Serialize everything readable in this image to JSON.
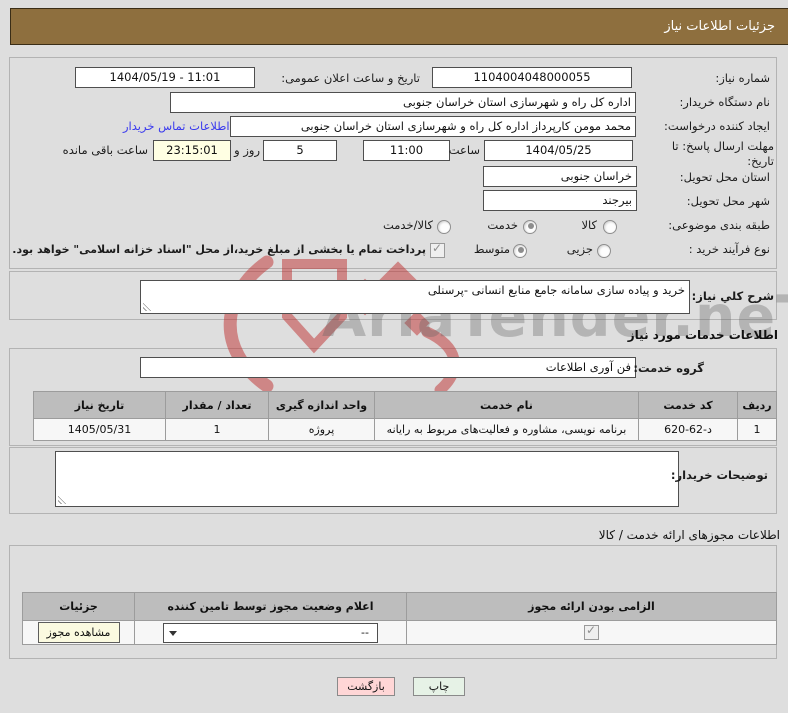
{
  "title": "جزئیات اطلاعات نیاز",
  "watermark": {
    "text": "AriaTender.neT"
  },
  "form": {
    "need_number": {
      "label": "شماره نیاز:",
      "value": "1104004048000055"
    },
    "announce": {
      "label": "تاریخ و ساعت اعلان عمومی:",
      "value": "1404/05/19 - 11:01"
    },
    "buyer_org": {
      "label": "نام دستگاه خریدار:",
      "value": "اداره کل راه و شهرسازی استان خراسان جنوبی"
    },
    "creator": {
      "label": "ایجاد کننده درخواست:",
      "value": "محمد مومن کارپرداز اداره کل راه و شهرسازی استان خراسان جنوبی",
      "contact_link": "اطلاعات تماس خریدار"
    },
    "deadline": {
      "label": "مهلت ارسال پاسخ: تا تاریخ:",
      "date": "1404/05/25",
      "time_label": "ساعت",
      "time": "11:00",
      "days": "5",
      "days_label": "روز و",
      "hours": "23:15:01",
      "remaining_label": "ساعت باقی مانده"
    },
    "province": {
      "label": "استان محل تحویل:",
      "value": "خراسان جنوبی"
    },
    "city": {
      "label": "شهر محل تحویل:",
      "value": "بیرجند"
    },
    "classification": {
      "label": "طبقه بندی موضوعی:",
      "options": [
        {
          "label": "کالا",
          "selected": false
        },
        {
          "label": "خدمت",
          "selected": true
        },
        {
          "label": "کالا/خدمت",
          "selected": false
        }
      ]
    },
    "process": {
      "label": "نوع فرآیند خرید :",
      "options": [
        {
          "label": "جزیی",
          "selected": false
        },
        {
          "label": "متوسط",
          "selected": true
        }
      ],
      "treasury_note": "پرداخت تمام یا بخشی از مبلغ خرید،از محل \"اسناد خزانه اسلامی\" خواهد بود.",
      "treasury_checked": true
    }
  },
  "description": {
    "label": "شرح کلي نیاز:",
    "value": "خرید و پیاده سازی سامانه جامع منابع انسانی -پرسنلی"
  },
  "services": {
    "heading": "اطلاعات خدمات مورد نیاز",
    "group_label": "گروه خدمت:",
    "group_value": "فن آوری اطلاعات",
    "table": {
      "headers": [
        "ردیف",
        "کد خدمت",
        "نام خدمت",
        "واحد اندازه گیری",
        "تعداد / مقدار",
        "تاریخ نیاز"
      ],
      "row": {
        "index": "1",
        "code": "620-62-د",
        "name": "برنامه نویسی، مشاوره و فعالیت‌های مربوط به رایانه",
        "unit": "پروژه",
        "qty": "1",
        "date": "1405/05/31"
      }
    }
  },
  "explanations": {
    "label": "توضیحات خریدار:",
    "value": ""
  },
  "licenses": {
    "heading": "اطلاعات مجوزهای ارائه خدمت / کالا",
    "table": {
      "headers": [
        "الزامی بودن ارائه مجوز",
        "اعلام وضعیت مجوز توسط تامین کننده",
        "جزئیات"
      ],
      "row": {
        "required_checked": true,
        "status_value": "--",
        "details_button": "مشاهده مجوز"
      }
    }
  },
  "actions": {
    "back": "بازگشت",
    "print": "چاپ"
  },
  "colors": {
    "titlebar": "#8e6f3e",
    "link": "#3a3aee",
    "remaining_bg": "#ffffe3",
    "back_bg": "#ffd6d6",
    "print_bg": "#e6f2e6",
    "details_btn_bg": "#fbfae0",
    "watermark_red": "#c03030"
  }
}
